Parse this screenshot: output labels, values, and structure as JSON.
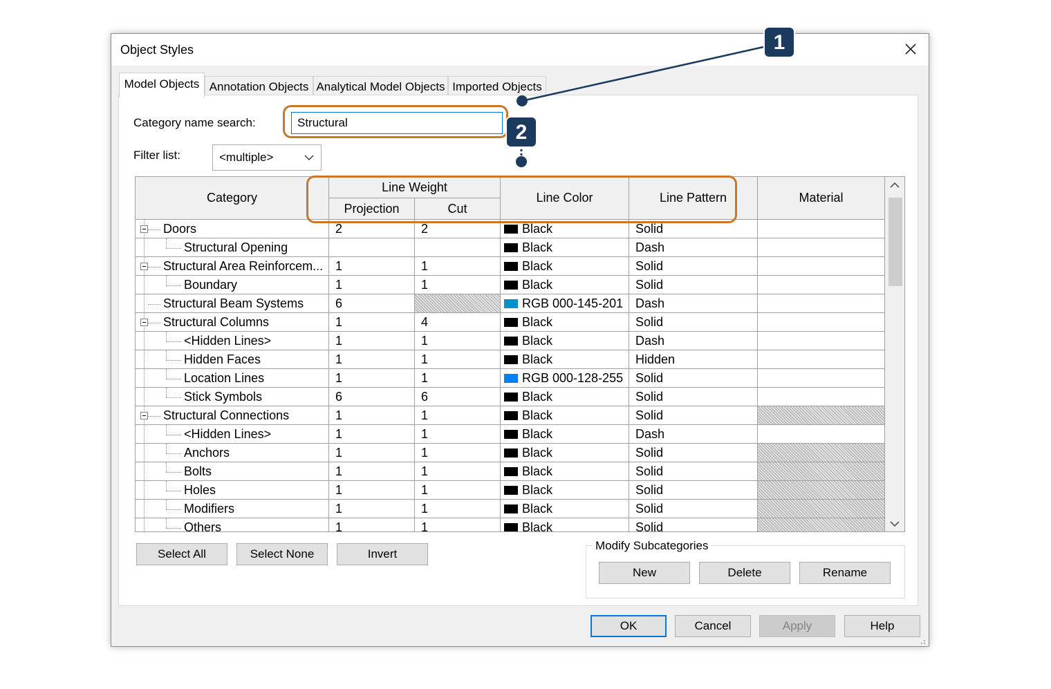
{
  "dialog": {
    "title": "Object Styles"
  },
  "tabs": [
    {
      "label": "Model Objects",
      "active": true
    },
    {
      "label": "Annotation Objects",
      "active": false
    },
    {
      "label": "Analytical Model Objects",
      "active": false
    },
    {
      "label": "Imported Objects",
      "active": false
    }
  ],
  "search": {
    "label": "Category name search:",
    "value": "Structural"
  },
  "filter": {
    "label": "Filter list:",
    "value": "<multiple>"
  },
  "grid": {
    "headers": {
      "category": "Category",
      "line_weight": "Line Weight",
      "projection": "Projection",
      "cut": "Cut",
      "line_color": "Line Color",
      "line_pattern": "Line Pattern",
      "material": "Material"
    },
    "rows": [
      {
        "name": "Doors",
        "level": 0,
        "expander": true,
        "projection": "2",
        "cut": "2",
        "color": "Black",
        "swatch": "#000000",
        "pattern": "Solid",
        "cut_hatched": false,
        "material_hatched": false
      },
      {
        "name": "Structural Opening",
        "level": 1,
        "expander": false,
        "projection": "",
        "cut": "",
        "color": "Black",
        "swatch": "#000000",
        "pattern": "Dash",
        "cut_hatched": false,
        "material_hatched": false
      },
      {
        "name": "Structural Area Reinforcem...",
        "level": 0,
        "expander": true,
        "projection": "1",
        "cut": "1",
        "color": "Black",
        "swatch": "#000000",
        "pattern": "Solid",
        "cut_hatched": false,
        "material_hatched": false
      },
      {
        "name": "Boundary",
        "level": 1,
        "expander": false,
        "projection": "1",
        "cut": "1",
        "color": "Black",
        "swatch": "#000000",
        "pattern": "Solid",
        "cut_hatched": false,
        "material_hatched": false
      },
      {
        "name": "Structural Beam Systems",
        "level": 0,
        "expander": false,
        "projection": "6",
        "cut": "",
        "color": "RGB 000-145-201",
        "swatch": "#0091c9",
        "pattern": "Dash",
        "cut_hatched": true,
        "material_hatched": false
      },
      {
        "name": "Structural Columns",
        "level": 0,
        "expander": true,
        "projection": "1",
        "cut": "4",
        "color": "Black",
        "swatch": "#000000",
        "pattern": "Solid",
        "cut_hatched": false,
        "material_hatched": false
      },
      {
        "name": "<Hidden Lines>",
        "level": 1,
        "expander": false,
        "projection": "1",
        "cut": "1",
        "color": "Black",
        "swatch": "#000000",
        "pattern": "Dash",
        "cut_hatched": false,
        "material_hatched": false
      },
      {
        "name": "Hidden Faces",
        "level": 1,
        "expander": false,
        "projection": "1",
        "cut": "1",
        "color": "Black",
        "swatch": "#000000",
        "pattern": "Hidden",
        "cut_hatched": false,
        "material_hatched": false
      },
      {
        "name": "Location Lines",
        "level": 1,
        "expander": false,
        "projection": "1",
        "cut": "1",
        "color": "RGB 000-128-255",
        "swatch": "#0080ff",
        "pattern": "Solid",
        "cut_hatched": false,
        "material_hatched": false
      },
      {
        "name": "Stick Symbols",
        "level": 1,
        "expander": false,
        "projection": "6",
        "cut": "6",
        "color": "Black",
        "swatch": "#000000",
        "pattern": "Solid",
        "cut_hatched": false,
        "material_hatched": false
      },
      {
        "name": "Structural Connections",
        "level": 0,
        "expander": true,
        "projection": "1",
        "cut": "1",
        "color": "Black",
        "swatch": "#000000",
        "pattern": "Solid",
        "cut_hatched": false,
        "material_hatched": true
      },
      {
        "name": "<Hidden Lines>",
        "level": 1,
        "expander": false,
        "projection": "1",
        "cut": "1",
        "color": "Black",
        "swatch": "#000000",
        "pattern": "Dash",
        "cut_hatched": false,
        "material_hatched": false
      },
      {
        "name": "Anchors",
        "level": 1,
        "expander": false,
        "projection": "1",
        "cut": "1",
        "color": "Black",
        "swatch": "#000000",
        "pattern": "Solid",
        "cut_hatched": false,
        "material_hatched": true
      },
      {
        "name": "Bolts",
        "level": 1,
        "expander": false,
        "projection": "1",
        "cut": "1",
        "color": "Black",
        "swatch": "#000000",
        "pattern": "Solid",
        "cut_hatched": false,
        "material_hatched": true
      },
      {
        "name": "Holes",
        "level": 1,
        "expander": false,
        "projection": "1",
        "cut": "1",
        "color": "Black",
        "swatch": "#000000",
        "pattern": "Solid",
        "cut_hatched": false,
        "material_hatched": true
      },
      {
        "name": "Modifiers",
        "level": 1,
        "expander": false,
        "projection": "1",
        "cut": "1",
        "color": "Black",
        "swatch": "#000000",
        "pattern": "Solid",
        "cut_hatched": false,
        "material_hatched": true
      },
      {
        "name": "Others",
        "level": 1,
        "expander": false,
        "projection": "1",
        "cut": "1",
        "color": "Black",
        "swatch": "#000000",
        "pattern": "Solid",
        "cut_hatched": false,
        "material_hatched": true
      }
    ]
  },
  "buttons": {
    "select_all": "Select All",
    "select_none": "Select None",
    "invert": "Invert",
    "modify_subcategories": "Modify Subcategories",
    "new": "New",
    "delete": "Delete",
    "rename": "Rename",
    "ok": "OK",
    "cancel": "Cancel",
    "apply": "Apply",
    "help": "Help"
  },
  "callouts": [
    {
      "number": "1"
    },
    {
      "number": "2"
    }
  ],
  "colors": {
    "callout_outline": "#c8782a",
    "badge": "#1c3a5e",
    "focus_blue": "#0078d7"
  }
}
